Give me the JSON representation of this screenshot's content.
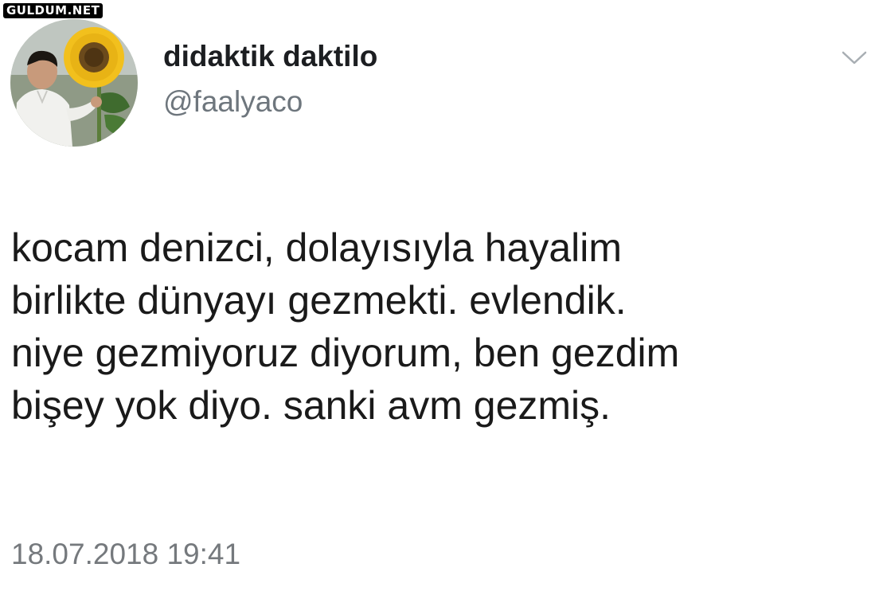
{
  "watermark": "GULDUM.NET",
  "tweet": {
    "author_name": "didaktik daktilo",
    "author_handle": "@faalyaco",
    "lines": [
      "kocam denizci, dolayısıyla hayalim",
      "birlikte dünyayı gezmekti. evlendik.",
      "niye gezmiyoruz diyorum, ben gezdim",
      "bişey yok diyo. sanki avm gezmiş."
    ],
    "timestamp": "18.07.2018 19:41"
  },
  "icons": {
    "menu": "chevron-down-icon"
  }
}
